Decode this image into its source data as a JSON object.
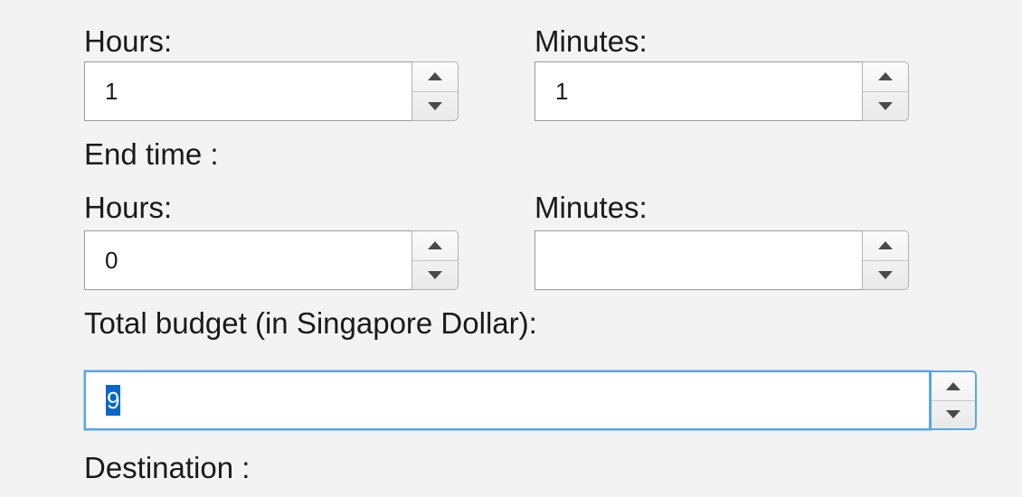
{
  "start_time": {
    "hours_label": "Hours:",
    "minutes_label": "Minutes:",
    "hours_value": "1",
    "minutes_value": "1"
  },
  "end_time": {
    "title": "End time :",
    "hours_label": "Hours:",
    "minutes_label": "Minutes:",
    "hours_value": "0",
    "minutes_value": ""
  },
  "budget": {
    "label": "Total budget (in Singapore Dollar):",
    "value": "9"
  },
  "destination": {
    "label": "Destination :"
  },
  "icons": {
    "increment": "chevron-up-icon",
    "decrement": "chevron-down-icon"
  },
  "colors": {
    "background": "#f3f3f3",
    "focus_border": "#5aa6e6",
    "selection": "#0a67c9"
  }
}
